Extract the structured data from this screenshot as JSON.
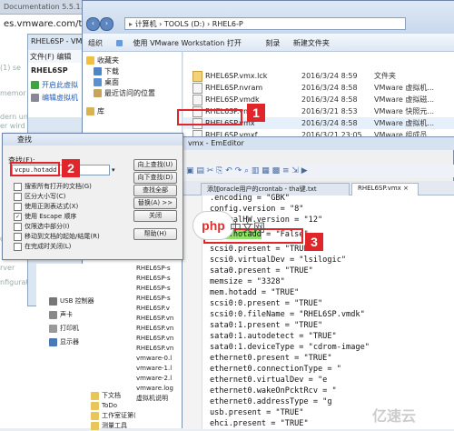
{
  "browser": {
    "tab_title": "Documentation 5.5.1...",
    "url": "es.vmware.com/thw",
    "lines": [
      "(1) se",
      "memor",
      "dern und",
      "er wird",
      "on",
      "rver",
      "nfigurati"
    ]
  },
  "vmware": {
    "title": "RHEL6SP - VM",
    "menu": [
      "文件(F)",
      "编辑"
    ],
    "library": [
      "RHEL6SP",
      "开启此虚拟",
      "编辑虚拟机"
    ]
  },
  "explorer": {
    "address": "计算机 › TOOLS (D:) › RHEL6-P",
    "toolbar": [
      "组织",
      "使用 VMware Workstation 打开",
      "刻录",
      "新建文件夹"
    ],
    "nav": [
      "收藏夹",
      "下载",
      "桌面",
      "最近访问的位置",
      "库"
    ],
    "files": [
      {
        "name": "RHEL6SP.vmx.lck",
        "date": "2016/3/24 8:59",
        "type": "文件夹"
      },
      {
        "name": "RHEL6SP.nvram",
        "date": "2016/3/24 8:58",
        "type": "VMware 虚拟机..."
      },
      {
        "name": "RHEL6SP.vmdk",
        "date": "2016/3/24 8:58",
        "type": "VMware 虚拟磁..."
      },
      {
        "name": "RHEL6SP.vmsd",
        "date": "2016/3/21 8:53",
        "type": "VMware 快照元..."
      },
      {
        "name": "RHEL6SP.vmx",
        "date": "2016/3/24 8:58",
        "type": "VMware 虚拟机..."
      },
      {
        "name": "RHEL6SP.vmxf",
        "date": "2016/3/21 23:05",
        "type": "VMware 组成员"
      }
    ]
  },
  "lower_tree": {
    "left": [
      "USB 控制器",
      "声卡",
      "打印机",
      "显示器"
    ],
    "right": [
      "RHEL6SP-s",
      "RHEL6SP-s",
      "RHEL6SP-s",
      "RHEL6SP-s",
      "RHEL6SP.v",
      "RHEL6SP.vn",
      "RHEL6SP.vn",
      "RHEL6SP.vn",
      "RHEL6SP.vn",
      "vmware-0.l",
      "vmware-1.l",
      "vmware-2.l",
      "vmware.log",
      "虚拟机说明"
    ],
    "bottom": [
      "下文档",
      "ToDo",
      "工作室证第(",
      "测量工具"
    ]
  },
  "emeditor": {
    "title": "vmx - EmEditor",
    "tabs": [
      "添加oracle用户的crontab - tha键.txt",
      "RHEL6SP.vmx ×"
    ],
    "code_lines": [
      ".encoding = \"GBK\"",
      "config.version = \"8\"",
      "virtualHW.version = \"12\"",
      "vcpu.hotadd = \"False\"",
      "scsi0.present = \"TRUE\"",
      "scsi0.virtualDev = \"lsilogic\"",
      "sata0.present = \"TRUE\"",
      "memsize = \"3328\"",
      "mem.hotadd = \"TRUE\"",
      "scsi0:0.present = \"TRUE\"",
      "scsi0:0.fileName = \"RHEL6SP.vmdk\"",
      "sata0:1.present = \"TRUE\"",
      "sata0:1.autodetect = \"TRUE\"",
      "sata0:1.deviceType = \"cdrom-image\"",
      "ethernet0.present = \"TRUE\"",
      "ethernet0.connectionType = \"",
      "ethernet0.virtualDev = \"e",
      "ethernet0.wakeOnPcktRcv = \"",
      "ethernet0.addressType = \"g",
      "usb.present = \"TRUE\"",
      "ehci.present = \"TRUE\""
    ]
  },
  "find": {
    "title": "查找",
    "label": "查找(F):",
    "value": "vcpu.hotadd",
    "buttons": [
      "向上查找(U)",
      "向下查找(D)",
      "查找全部",
      "替换(A) >>",
      "关闭",
      "帮助(H)"
    ],
    "checks": [
      {
        "label": "搜索所有打开的文档(G)",
        "checked": false
      },
      {
        "label": "区分大小写(C)",
        "checked": false
      },
      {
        "label": "使用正则表达式(X)",
        "checked": false
      },
      {
        "label": "使用 Escape 顺序",
        "checked": true
      },
      {
        "label": "仅限选中部分(I)",
        "checked": false
      },
      {
        "label": "移动到文档的起始/结尾(R)",
        "checked": false
      },
      {
        "label": "在完成时关闭(L)",
        "checked": false
      }
    ]
  },
  "callouts": [
    "1",
    "2",
    "3"
  ],
  "watermark": {
    "php": "php",
    "cn": "中文网",
    "corner": "亿速云"
  },
  "colors": {
    "annotation_red": "#e0262b",
    "highlight_green": "#8ee06a"
  }
}
